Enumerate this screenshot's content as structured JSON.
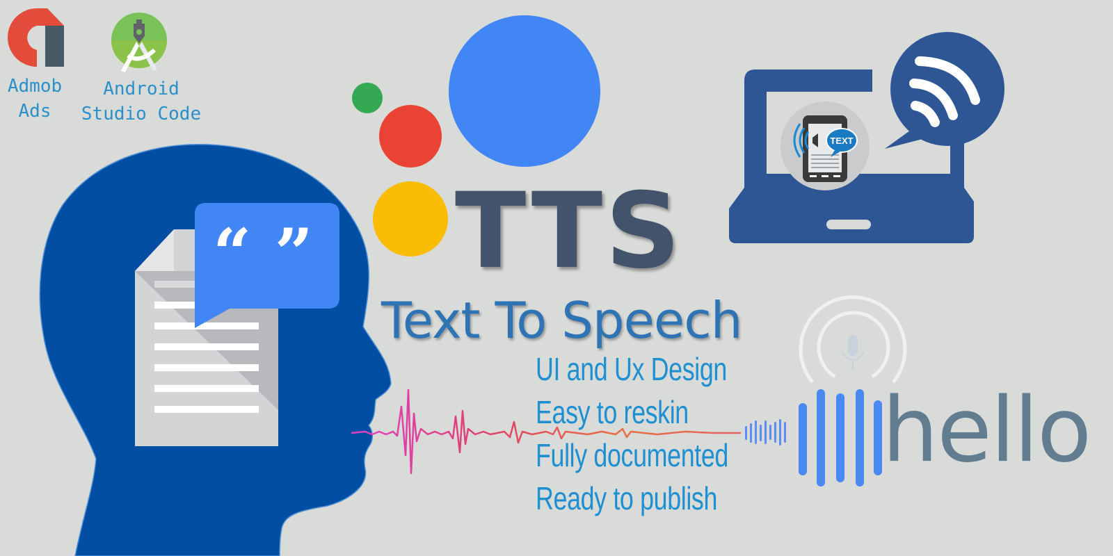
{
  "banner": {
    "title": "TTS",
    "heading": "Text To Speech",
    "features": [
      "UI and Ux Design",
      "Easy to reskin",
      "Fully documented",
      "Ready to publish"
    ],
    "hello_text": "hello",
    "text_bubble_label": "TEXT",
    "quote_glyph": "“ ”"
  },
  "logos": [
    {
      "name": "admob",
      "label_line1": "Admob",
      "label_line2": "Ads",
      "icon": "admob-logo-icon"
    },
    {
      "name": "android-studio",
      "label_line1": "Android",
      "label_line2": "Studio Code",
      "icon": "android-studio-logo-icon"
    }
  ],
  "colors": {
    "background": "#d9dbd9",
    "assistant_blue": "#4285f4",
    "assistant_red": "#ea4335",
    "assistant_yellow": "#fbbc05",
    "assistant_green": "#34a853",
    "head_blue": "#024ea2",
    "laptop_blue": "#2e5594",
    "heading_blue": "#2e74b5",
    "feature_blue": "#1e8fd0",
    "title_slate": "#43536b",
    "hello_slate": "#617d8f",
    "logo_label_blue": "#2b8fc9"
  }
}
